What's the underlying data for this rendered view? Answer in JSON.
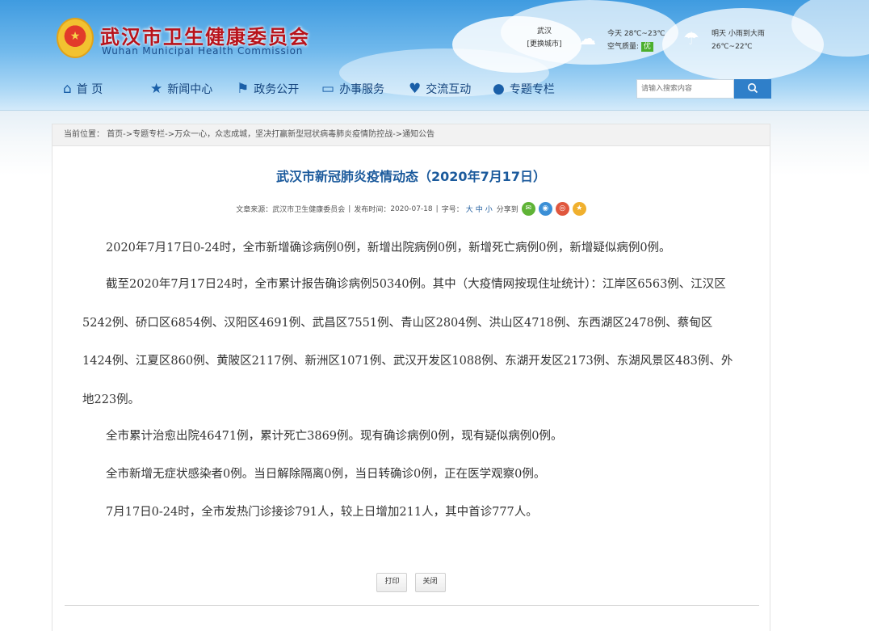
{
  "header": {
    "title": "武汉市卫生健康委员会",
    "subtitle": "Wuhan Municipal Health Commission",
    "weather": {
      "city": "武汉",
      "city_switch": "[更换城市]",
      "today": "今天 28℃~23℃",
      "air_quality_label": "空气质量:",
      "air_quality_value": "优",
      "tomorrow": "明天 小雨到大雨",
      "tomorrow_temp": "26℃~22℃"
    }
  },
  "nav": {
    "items": [
      {
        "label": "首 页",
        "icon": "home-icon"
      },
      {
        "label": "新闻中心",
        "icon": "star-icon"
      },
      {
        "label": "政务公开",
        "icon": "flag-icon"
      },
      {
        "label": "办事服务",
        "icon": "monitor-icon"
      },
      {
        "label": "交流互动",
        "icon": "heart-icon"
      },
      {
        "label": "专题专栏",
        "icon": "chat-icon"
      }
    ]
  },
  "search": {
    "placeholder": "请输入搜索内容",
    "icon": "search-icon"
  },
  "breadcrumb": {
    "prefix": "当前位置：",
    "path": "首页->专题专栏->万众一心，众志成城，坚决打赢新型冠状病毒肺炎疫情防控战->通知公告"
  },
  "article": {
    "title": "武汉市新冠肺炎疫情动态（2020年7月17日）",
    "meta": {
      "source_label": "文章来源：",
      "source": "武汉市卫生健康委员会",
      "date_label": "发布时间：",
      "date": "2020-07-18",
      "font_label": "字号：",
      "font_large": "大",
      "font_medium": "中",
      "font_small": "小",
      "share_label": "分享到"
    },
    "paragraphs": {
      "p1": "2020年7月17日0-24时，全市新增确诊病例0例，新增出院病例0例，新增死亡病例0例，新增疑似病例0例。",
      "p2": "截至2020年7月17日24时，全市累计报告确诊病例50340例。其中（大疫情网按现住址统计）：江岸区6563例、江汉区5242例、硚口区6854例、汉阳区4691例、武昌区7551例、青山区2804例、洪山区4718例、东西湖区2478例、蔡甸区1424例、江夏区860例、黄陂区2117例、新洲区1071例、武汉开发区1088例、东湖开发区2173例、东湖风景区483例、外地223例。",
      "p3": "全市累计治愈出院46471例，累计死亡3869例。现有确诊病例0例，现有疑似病例0例。",
      "p4": "全市新增无症状感染者0例。当日解除隔离0例，当日转确诊0例，正在医学观察0例。",
      "p5": "7月17日0-24时，全市发热门诊接诊791人，较上日增加211人，其中首诊777人。"
    },
    "buttons": {
      "print": "打印",
      "close": "关闭"
    }
  }
}
